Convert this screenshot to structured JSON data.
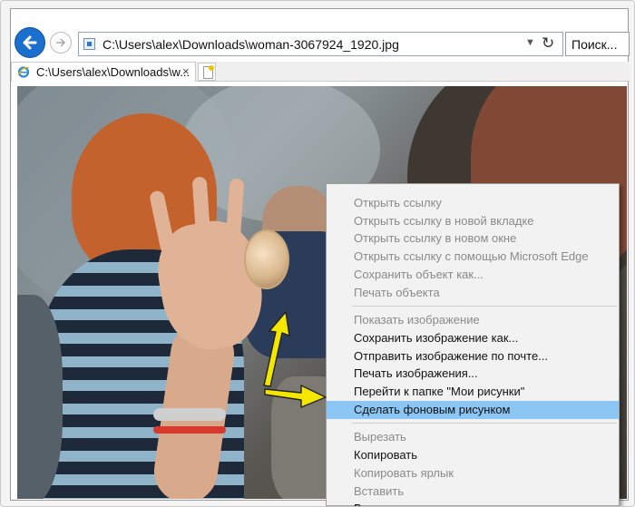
{
  "browser": {
    "address_url": "C:\\Users\\alex\\Downloads\\woman-3067924_1920.jpg",
    "search_placeholder": "Поиск...",
    "tab_title": "C:\\Users\\alex\\Downloads\\w...",
    "tab_close": "×",
    "dropdown_glyph": "▼",
    "refresh_glyph": "↻"
  },
  "icons": {
    "back": "back-arrow-icon",
    "forward": "forward-arrow-icon",
    "refresh": "refresh-icon",
    "page": "page-icon",
    "ie": "internet-explorer-icon",
    "new_tab": "new-tab-icon"
  },
  "context_menu": {
    "items": [
      {
        "label": "Открыть ссылку",
        "enabled": false
      },
      {
        "label": "Открыть ссылку в новой вкладке",
        "enabled": false
      },
      {
        "label": "Открыть ссылку в новом окне",
        "enabled": false
      },
      {
        "label": "Открыть ссылку с помощью Microsoft Edge",
        "enabled": false
      },
      {
        "label": "Сохранить объект как...",
        "enabled": false
      },
      {
        "label": "Печать объекта",
        "enabled": false
      },
      {
        "label": "Показать изображение",
        "enabled": false
      },
      {
        "label": "Сохранить изображение как...",
        "enabled": true
      },
      {
        "label": "Отправить изображение по почте...",
        "enabled": true
      },
      {
        "label": "Печать изображения...",
        "enabled": true
      },
      {
        "label": "Перейти к папке \"Мои рисунки\"",
        "enabled": true
      },
      {
        "label": "Сделать фоновым рисунком",
        "enabled": true,
        "highlighted": true
      },
      {
        "label": "Вырезать",
        "enabled": false
      },
      {
        "label": "Копировать",
        "enabled": true
      },
      {
        "label": "Копировать ярлык",
        "enabled": false
      },
      {
        "label": "Вставить",
        "enabled": false
      },
      {
        "label": "Выделить все",
        "enabled": true
      }
    ]
  },
  "colors": {
    "accent_blue": "#1a6fcf",
    "menu_highlight": "#8cc6f5",
    "annotation_arrow": "#f5e600"
  }
}
